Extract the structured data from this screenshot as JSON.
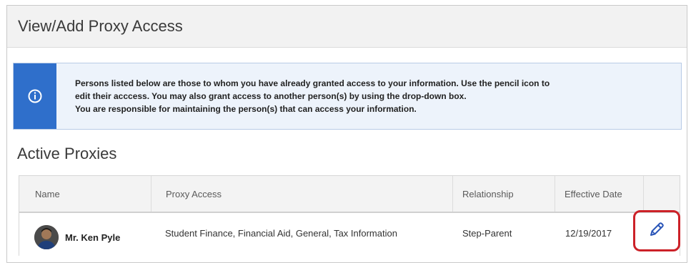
{
  "page": {
    "title": "View/Add Proxy Access"
  },
  "info": {
    "icon": "info-icon",
    "lines": [
      "Persons listed below are those to whom you have already granted access to your information. Use the pencil icon to",
      "edit their acccess. You may also grant access to another person(s) by using the drop-down box.",
      "You are responsible for maintaining the person(s) that can access your information."
    ]
  },
  "section": {
    "title": "Active Proxies"
  },
  "table": {
    "headers": [
      "Name",
      "Proxy Access",
      "Relationship",
      "Effective Date"
    ],
    "rows": [
      {
        "name": "Mr. Ken Pyle",
        "proxy_access": "Student Finance, Financial Aid, General, Tax Information",
        "relationship": "Step-Parent",
        "effective_date": "12/19/2017",
        "action_icon": "pencil-icon"
      }
    ]
  },
  "colors": {
    "accent": "#2f6fcb",
    "highlight": "#cc2128",
    "info_background": "#edf3fb"
  }
}
